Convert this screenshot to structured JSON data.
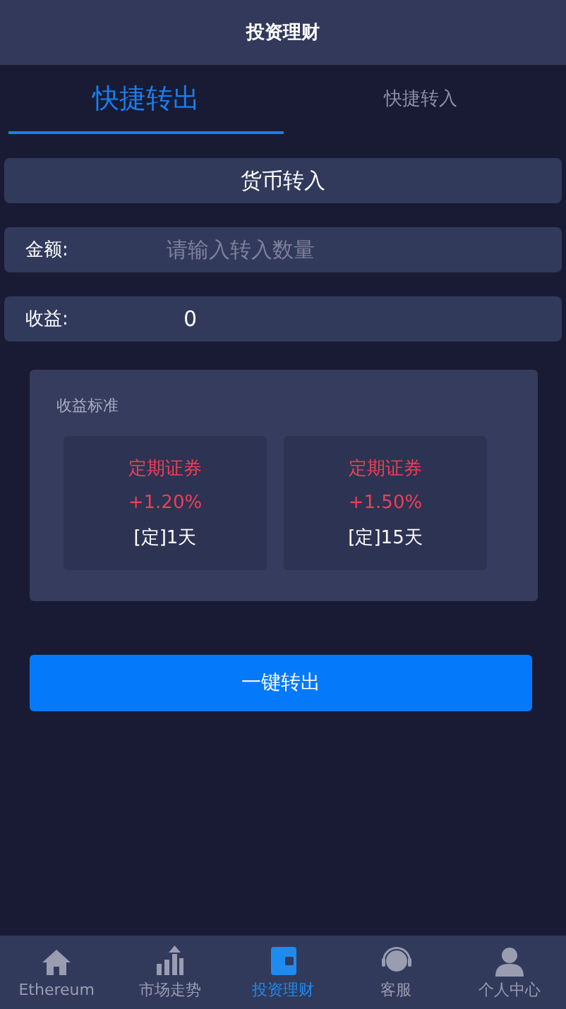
{
  "header": {
    "title": "投资理财"
  },
  "tabs": [
    {
      "label": "快捷转出",
      "selected": true
    },
    {
      "label": "快捷转入",
      "selected": false
    }
  ],
  "section_title": "货币转入",
  "amount": {
    "label": "金额:",
    "placeholder": "请输入转入数量"
  },
  "earnings": {
    "label": "收益:",
    "value": "0"
  },
  "standards": {
    "title": "收益标准",
    "plans": [
      {
        "name": "定期证券",
        "rate": "+1.20%",
        "term": "[定]1天"
      },
      {
        "name": "定期证券",
        "rate": "+1.50%",
        "term": "[定]15天"
      }
    ]
  },
  "submit": "一键转出",
  "nav": [
    {
      "kind": "home",
      "label": "Ethereum",
      "selected": false
    },
    {
      "kind": "chart",
      "label": "市场走势",
      "selected": false
    },
    {
      "kind": "wallet",
      "label": "投资理财",
      "selected": true
    },
    {
      "kind": "support",
      "label": "客服",
      "selected": false
    },
    {
      "kind": "user",
      "label": "个人中心",
      "selected": false
    }
  ]
}
